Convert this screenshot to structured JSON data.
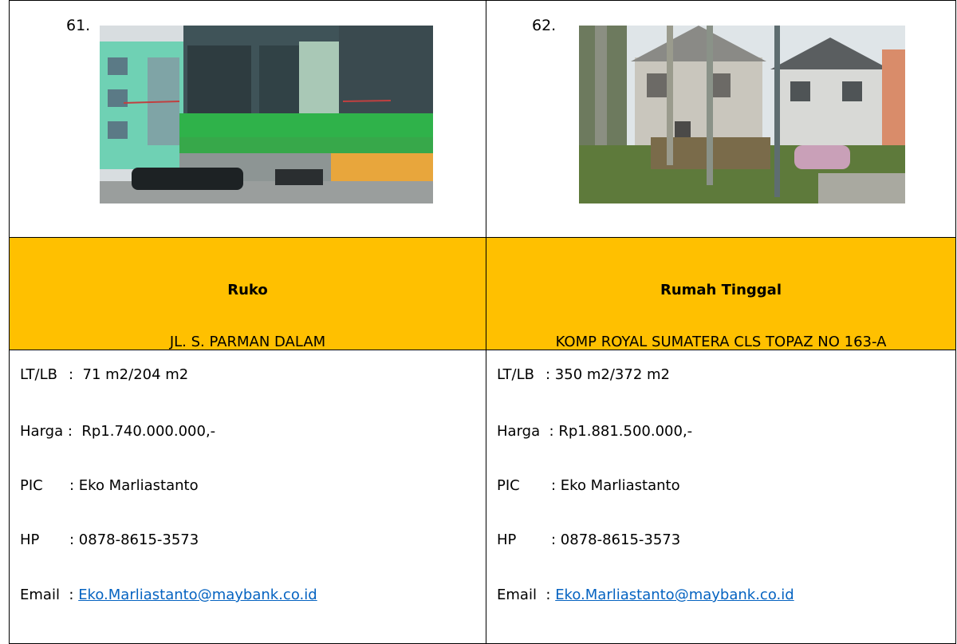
{
  "listings": [
    {
      "number": "61.",
      "type": "Ruko",
      "address": "JL. S. PARMAN DALAM",
      "lt_lb_label": "LT/LB",
      "lt_lb_value": "71 m2/204 m2",
      "price_label": "Harga",
      "price_value": "Rp1.740.000.000,-",
      "pic_label": "PIC",
      "pic_value": "Eko Marliastanto",
      "hp_label": "HP",
      "hp_value": "0878-8615-3573",
      "email_label": "Email",
      "email_value": "Eko.Marliastanto@maybank.co.id"
    },
    {
      "number": "62.",
      "type": "Rumah Tinggal",
      "address": "KOMP ROYAL SUMATERA CLS TOPAZ NO 163-A",
      "lt_lb_label": "LT/LB",
      "lt_lb_value": "350 m2/372 m2",
      "price_label": "Harga",
      "price_value": "Rp1.881.500.000,-",
      "pic_label": "PIC",
      "pic_value": "Eko Marliastanto",
      "hp_label": "HP",
      "hp_value": "0878-8615-3573",
      "email_label": "Email",
      "email_value": "Eko.Marliastanto@maybank.co.id"
    }
  ],
  "colors": {
    "header_bg": "#ffc000",
    "link": "#0563c1"
  }
}
